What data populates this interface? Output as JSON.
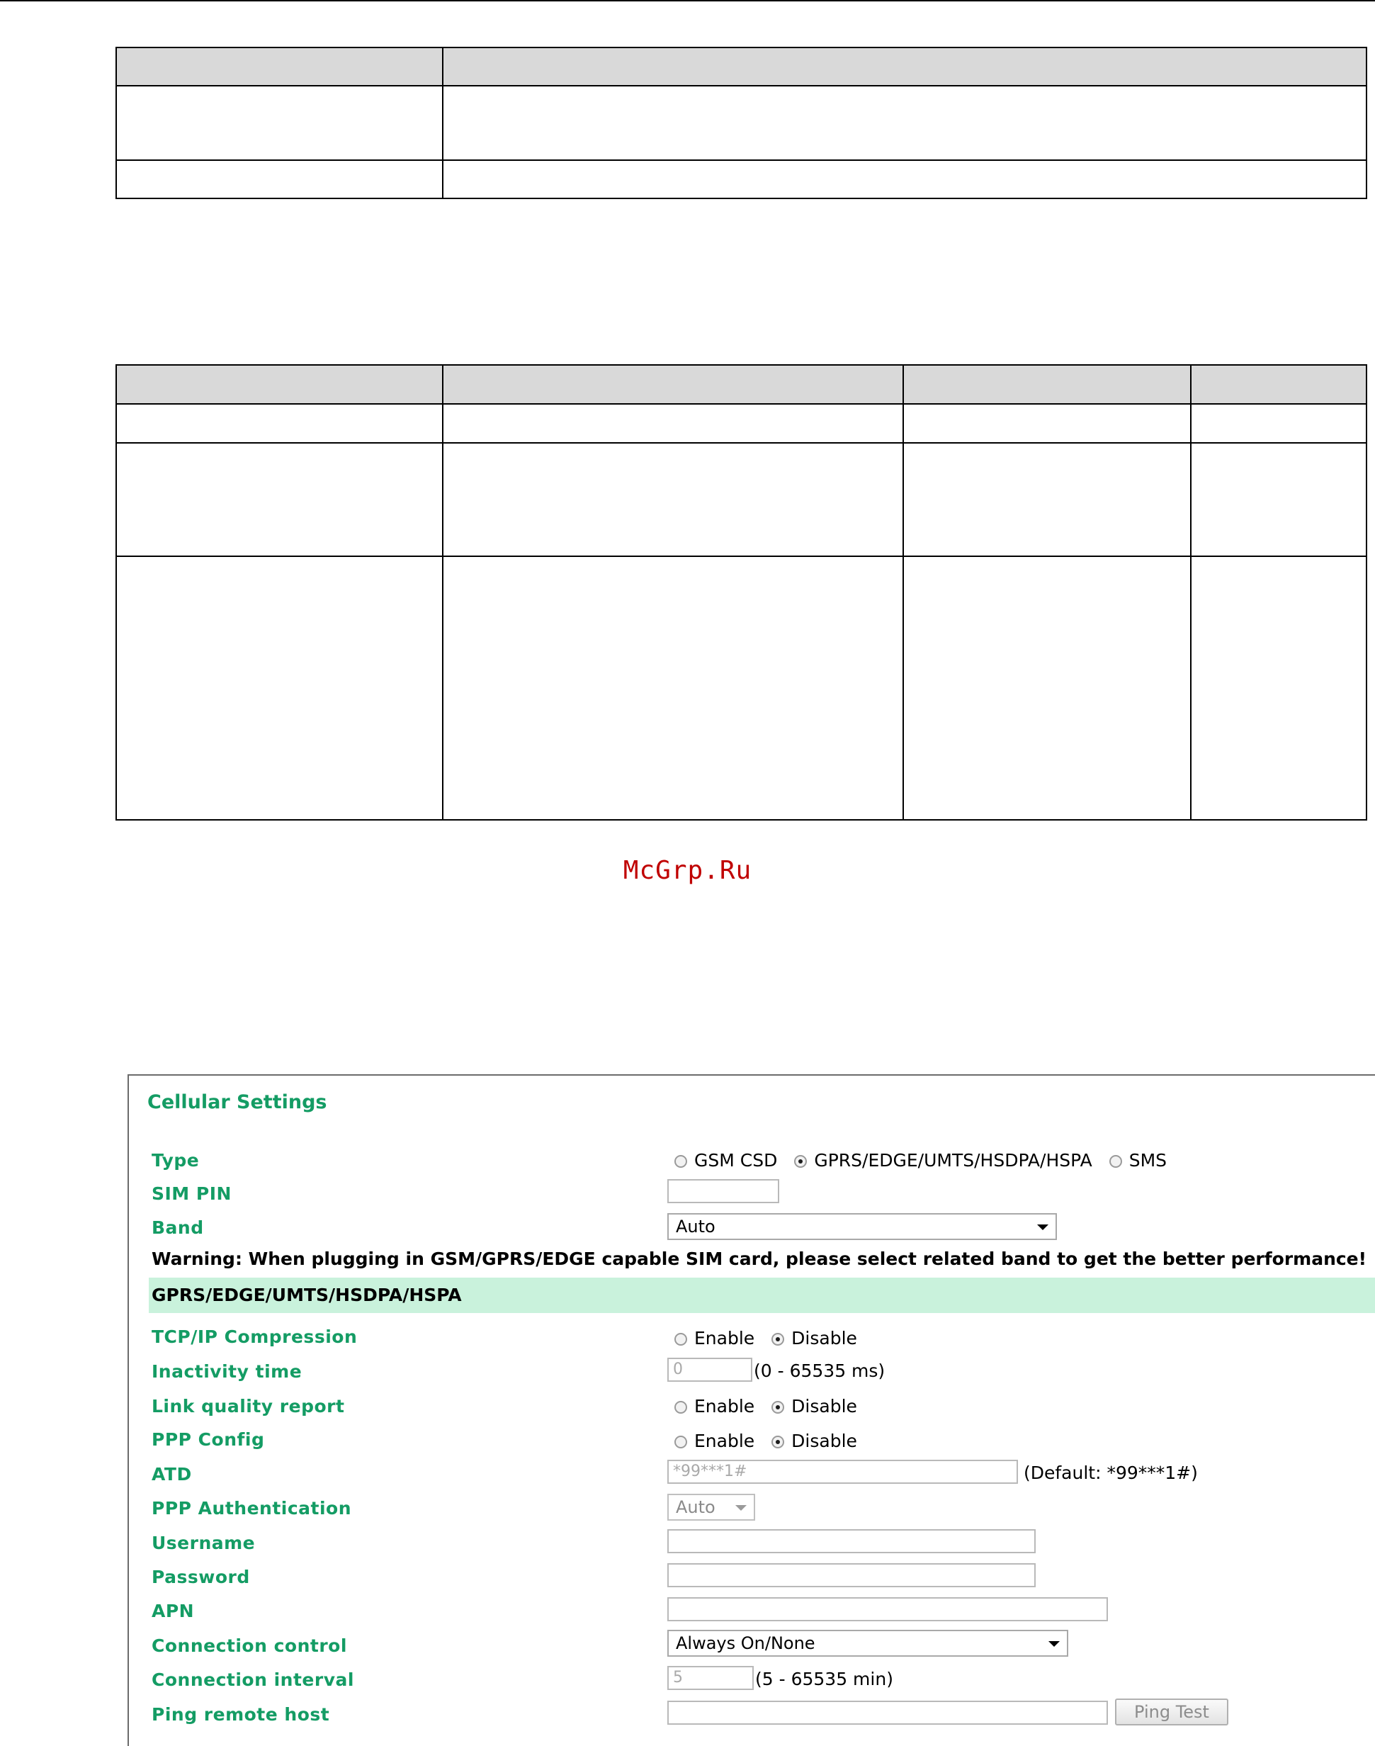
{
  "watermark": "McGrp.Ru",
  "cellular": {
    "title": "Cellular Settings",
    "type": {
      "label": "Type",
      "options": [
        "GSM CSD",
        "GPRS/EDGE/UMTS/HSDPA/HSPA",
        "SMS"
      ],
      "selected": "GPRS/EDGE/UMTS/HSDPA/HSPA"
    },
    "sim_pin": {
      "label": "SIM PIN",
      "value": ""
    },
    "band": {
      "label": "Band",
      "value": "Auto"
    },
    "warning": "Warning: When plugging in GSM/GPRS/EDGE capable SIM card, please select related band to get the better performance!",
    "section_title": "GPRS/EDGE/UMTS/HSDPA/HSPA",
    "tcpip_compression": {
      "label": "TCP/IP Compression",
      "enable": "Enable",
      "disable": "Disable",
      "selected": "Disable"
    },
    "inactivity_time": {
      "label": "Inactivity time",
      "value": "0",
      "hint": "(0 - 65535 ms)"
    },
    "link_quality_report": {
      "label": "Link quality report",
      "enable": "Enable",
      "disable": "Disable",
      "selected": "Disable"
    },
    "ppp_config": {
      "label": "PPP Config",
      "enable": "Enable",
      "disable": "Disable",
      "selected": "Disable"
    },
    "atd": {
      "label": "ATD",
      "value": "*99***1#",
      "hint": "(Default: *99***1#)"
    },
    "ppp_auth": {
      "label": "PPP Authentication",
      "value": "Auto"
    },
    "username": {
      "label": "Username",
      "value": ""
    },
    "password": {
      "label": "Password",
      "value": ""
    },
    "apn": {
      "label": "APN",
      "value": ""
    },
    "connection_control": {
      "label": "Connection control",
      "value": "Always On/None"
    },
    "connection_interval": {
      "label": "Connection interval",
      "value": "5",
      "hint": "(5 - 65535 min)"
    },
    "ping_remote_host": {
      "label": "Ping remote host",
      "value": "",
      "button": "Ping Test"
    }
  }
}
